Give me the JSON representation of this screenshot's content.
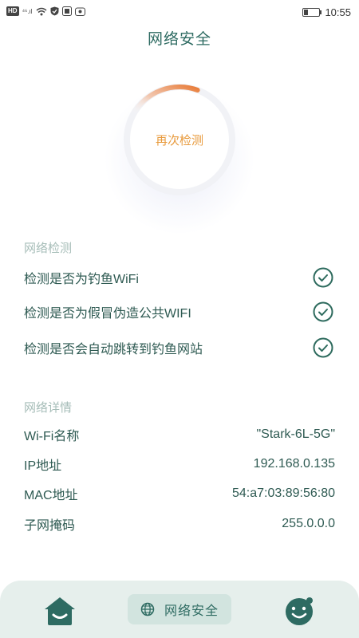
{
  "status_bar": {
    "left_badge": "HD",
    "signal_text": "⁴⁶.ıl",
    "time": "10:55",
    "battery_level": 0.3
  },
  "header": {
    "title": "网络安全"
  },
  "scan": {
    "button_label": "再次检测",
    "progress": 0.15
  },
  "detection": {
    "section_title": "网络检测",
    "items": [
      {
        "label": "检测是否为钓鱼WiFi",
        "status": "passed"
      },
      {
        "label": "检测是否为假冒伪造公共WIFI",
        "status": "passed"
      },
      {
        "label": "检测是否会自动跳转到钓鱼网站",
        "status": "passed"
      }
    ]
  },
  "details": {
    "section_title": "网络详情",
    "rows": [
      {
        "label": "Wi-Fi名称",
        "value": "\"Stark-6L-5G\""
      },
      {
        "label": "IP地址",
        "value": "192.168.0.135"
      },
      {
        "label": "MAC地址",
        "value": "54:a7:03:89:56:80"
      },
      {
        "label": "子网掩码",
        "value": "255.0.0.0"
      }
    ]
  },
  "bottom_nav": {
    "items": [
      {
        "icon": "home-icon"
      },
      {
        "icon": "globe-icon",
        "label": "网络安全",
        "active": true
      },
      {
        "icon": "smiley-face-icon"
      }
    ]
  },
  "colors": {
    "primary": "#2e6b62",
    "accent_orange": "#e87f3a",
    "check_green": "#2e6b5e",
    "nav_background": "#e6efec"
  }
}
